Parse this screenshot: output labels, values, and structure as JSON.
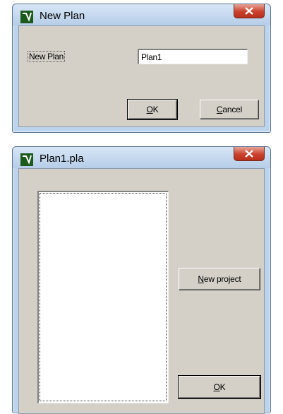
{
  "dialog1": {
    "title": "New Plan",
    "label": "New Plan",
    "input_value": "Plan1",
    "ok_key": "O",
    "ok_rest": "K",
    "cancel_key": "C",
    "cancel_rest": "ancel"
  },
  "dialog2": {
    "title": "Plan1.pla",
    "list_items": [],
    "new_project_key": "N",
    "new_project_rest": "ew project",
    "ok_key": "O",
    "ok_rest": "K"
  },
  "colors": {
    "frame": "#bcd3ec",
    "client": "#d4d0c8",
    "close": "#c9402c"
  },
  "icons": [
    "app-icon",
    "close-icon"
  ]
}
